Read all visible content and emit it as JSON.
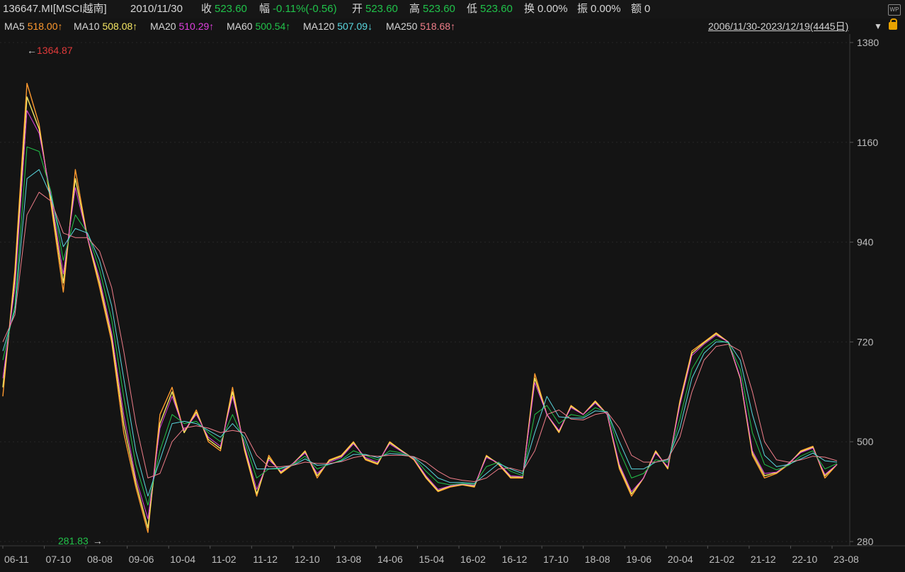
{
  "header": {
    "code": "136647.MI[MSCI越南]",
    "date": "2010/11/30",
    "close_label": "收",
    "close_value": "523.60",
    "change_label": "幅",
    "change_value": "-0.11%(-0.56)",
    "open_label": "开",
    "open_value": "523.60",
    "high_label": "高",
    "high_value": "523.60",
    "low_label": "低",
    "low_value": "523.60",
    "turnover_label": "换",
    "turnover_value": "0.00%",
    "amplitude_label": "振",
    "amplitude_value": "0.00%",
    "amount_label": "额",
    "amount_value": "0",
    "wp_label": "WP"
  },
  "ma_bar": {
    "items": [
      {
        "label": "MA5",
        "value": "518.00↑",
        "color": "#ff9a2e"
      },
      {
        "label": "MA10",
        "value": "508.08↑",
        "color": "#f5e663"
      },
      {
        "label": "MA20",
        "value": "510.29↑",
        "color": "#e040e0"
      },
      {
        "label": "MA60",
        "value": "500.54↑",
        "color": "#22c24a"
      },
      {
        "label": "MA120",
        "value": "507.09↓",
        "color": "#5ad8e0"
      },
      {
        "label": "MA250",
        "value": "518.68↑",
        "color": "#f07e8a"
      }
    ],
    "range": "2006/11/30-2023/12/19(4445日)"
  },
  "chart_data": {
    "type": "line",
    "ylim": [
      280,
      1380
    ],
    "yticks": [
      "1380",
      "1160",
      "940",
      "720",
      "500",
      "280"
    ],
    "xticks": [
      "06-11",
      "07-10",
      "08-08",
      "09-06",
      "10-04",
      "11-02",
      "11-12",
      "12-10",
      "13-08",
      "14-06",
      "15-04",
      "16-02",
      "16-12",
      "17-10",
      "18-08",
      "19-06",
      "20-04",
      "21-02",
      "21-12",
      "22-10",
      "23-08"
    ],
    "max_label": "1364.87",
    "min_label": "281.83",
    "series": [
      {
        "name": "MA5",
        "color": "#ff9a2e",
        "values": [
          600,
          880,
          1290,
          1200,
          1020,
          830,
          1100,
          950,
          840,
          720,
          520,
          400,
          300,
          560,
          620,
          520,
          570,
          500,
          480,
          620,
          480,
          380,
          470,
          430,
          450,
          480,
          420,
          460,
          470,
          500,
          460,
          450,
          500,
          480,
          460,
          420,
          390,
          400,
          405,
          400,
          470,
          450,
          420,
          420,
          650,
          560,
          520,
          580,
          560,
          590,
          560,
          440,
          380,
          420,
          480,
          440,
          590,
          700,
          720,
          740,
          720,
          640,
          470,
          420,
          430,
          450,
          480,
          490,
          420,
          450
        ]
      },
      {
        "name": "MA10",
        "color": "#f5e663",
        "values": [
          620,
          860,
          1260,
          1190,
          1030,
          850,
          1080,
          950,
          850,
          730,
          540,
          410,
          310,
          540,
          610,
          520,
          565,
          505,
          485,
          610,
          485,
          385,
          465,
          432,
          452,
          478,
          425,
          458,
          468,
          498,
          462,
          452,
          498,
          480,
          462,
          422,
          392,
          402,
          406,
          402,
          468,
          452,
          422,
          422,
          640,
          560,
          522,
          578,
          560,
          588,
          560,
          445,
          385,
          420,
          478,
          442,
          585,
          695,
          718,
          738,
          720,
          640,
          475,
          425,
          432,
          452,
          478,
          488,
          425,
          450
        ]
      },
      {
        "name": "MA20",
        "color": "#e040e0",
        "values": [
          640,
          840,
          1230,
          1180,
          1040,
          870,
          1060,
          950,
          860,
          740,
          560,
          420,
          330,
          530,
          600,
          525,
          560,
          510,
          490,
          600,
          490,
          395,
          460,
          435,
          452,
          475,
          430,
          455,
          465,
          495,
          465,
          455,
          495,
          478,
          463,
          425,
          395,
          403,
          407,
          404,
          465,
          453,
          425,
          423,
          630,
          560,
          525,
          575,
          560,
          585,
          560,
          450,
          390,
          420,
          475,
          445,
          580,
          690,
          715,
          735,
          720,
          642,
          480,
          430,
          433,
          452,
          476,
          486,
          428,
          450
        ]
      },
      {
        "name": "MA60",
        "color": "#22c24a",
        "values": [
          680,
          800,
          1150,
          1140,
          1050,
          900,
          1000,
          960,
          880,
          770,
          600,
          450,
          360,
          480,
          560,
          540,
          545,
          520,
          500,
          560,
          500,
          420,
          440,
          440,
          450,
          468,
          440,
          450,
          460,
          480,
          470,
          460,
          480,
          475,
          465,
          435,
          410,
          405,
          408,
          406,
          445,
          455,
          435,
          425,
          560,
          580,
          540,
          560,
          555,
          575,
          565,
          480,
          420,
          430,
          460,
          455,
          550,
          660,
          705,
          725,
          718,
          660,
          520,
          450,
          438,
          448,
          468,
          480,
          440,
          452
        ]
      },
      {
        "name": "MA120",
        "color": "#5ad8e0",
        "values": [
          700,
          790,
          1080,
          1100,
          1040,
          930,
          970,
          960,
          900,
          800,
          640,
          480,
          380,
          460,
          540,
          545,
          540,
          525,
          510,
          540,
          510,
          440,
          440,
          442,
          448,
          462,
          448,
          450,
          458,
          472,
          472,
          465,
          474,
          472,
          466,
          445,
          420,
          410,
          410,
          408,
          430,
          452,
          440,
          430,
          520,
          600,
          555,
          552,
          552,
          568,
          566,
          500,
          440,
          440,
          455,
          460,
          530,
          640,
          695,
          720,
          720,
          680,
          560,
          470,
          445,
          450,
          462,
          475,
          458,
          455
        ]
      },
      {
        "name": "MA250",
        "color": "#f07e8a",
        "values": [
          720,
          780,
          1000,
          1050,
          1030,
          960,
          950,
          950,
          920,
          840,
          700,
          540,
          420,
          430,
          500,
          530,
          535,
          530,
          520,
          525,
          520,
          470,
          445,
          445,
          448,
          455,
          452,
          452,
          456,
          465,
          470,
          468,
          470,
          470,
          467,
          455,
          435,
          420,
          415,
          412,
          420,
          440,
          442,
          435,
          480,
          560,
          570,
          550,
          548,
          560,
          565,
          530,
          470,
          455,
          455,
          462,
          510,
          610,
          680,
          710,
          715,
          700,
          610,
          500,
          460,
          455,
          460,
          468,
          466,
          458
        ]
      }
    ]
  }
}
